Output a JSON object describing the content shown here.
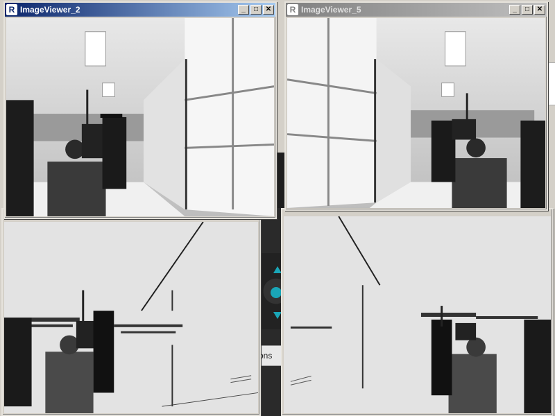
{
  "backdrop": {
    "partial_button_label": "ons"
  },
  "windows": [
    {
      "id": "viewer-2",
      "title": "ImageViewer_2",
      "active": true,
      "content": "grayscale camera frame"
    },
    {
      "id": "viewer-5",
      "title": "ImageViewer_5",
      "active": false,
      "content": "grayscale camera frame"
    },
    {
      "id": "viewer-bottom-left",
      "content": "thresholded depth frame"
    },
    {
      "id": "viewer-bottom-right",
      "content": "thresholded depth frame"
    }
  ],
  "controls": {
    "minimize": "_",
    "maximize": "□",
    "close": "✕"
  },
  "colors": {
    "title_active": "#0a246a",
    "title_inactive": "#808080",
    "accent": "#1aa6b7"
  }
}
